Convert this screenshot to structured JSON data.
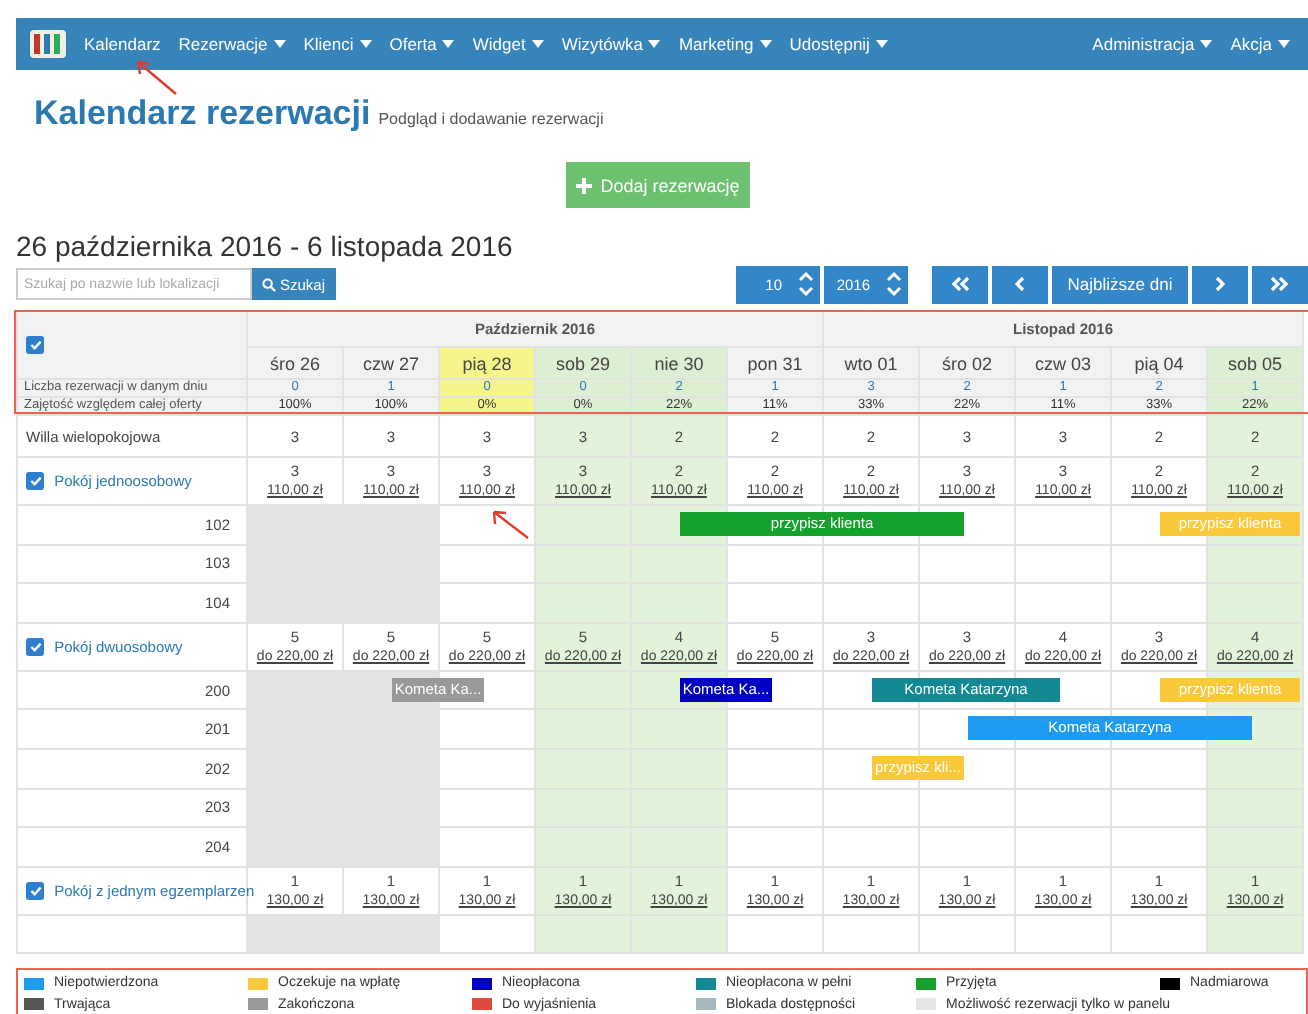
{
  "nav": {
    "items": [
      {
        "label": "Kalendarz",
        "dropdown": false
      },
      {
        "label": "Rezerwacje",
        "dropdown": true
      },
      {
        "label": "Klienci",
        "dropdown": true
      },
      {
        "label": "Oferta",
        "dropdown": true
      },
      {
        "label": "Widget",
        "dropdown": true
      },
      {
        "label": "Wizytówka",
        "dropdown": true
      },
      {
        "label": "Marketing",
        "dropdown": true
      },
      {
        "label": "Udostępnij",
        "dropdown": true
      }
    ],
    "right_items": [
      {
        "label": "Administracja",
        "dropdown": true
      },
      {
        "label": "Akcja",
        "dropdown": true
      }
    ]
  },
  "page": {
    "title": "Kalendarz rezerwacji",
    "subtitle": "Podgląd i dodawanie rezerwacji"
  },
  "add_button": "Dodaj rezerwację",
  "range_title": "26 października 2016 - 6 listopada 2016",
  "search": {
    "placeholder": "Szukaj po nazwie lub lokalizacji",
    "button": "Szukaj"
  },
  "pager": {
    "month": "10",
    "year": "2016",
    "nearest": "Najbliższe dni"
  },
  "calendar": {
    "select_all_checked": true,
    "stat_labels": [
      "Liczba rezerwacji w danym dniu",
      "Zajętość względem całej oferty"
    ],
    "months": [
      {
        "label": "Październik 2016",
        "days": [
          {
            "label": "śro 26",
            "kind": "past",
            "count": "0",
            "occupancy": "100%"
          },
          {
            "label": "czw 27",
            "kind": "past",
            "count": "1",
            "occupancy": "100%"
          },
          {
            "label": "pią 28",
            "kind": "today",
            "count": "0",
            "occupancy": "0%"
          },
          {
            "label": "sob 29",
            "kind": "weekend",
            "count": "0",
            "occupancy": "0%"
          },
          {
            "label": "nie 30",
            "kind": "weekend",
            "count": "2",
            "occupancy": "22%"
          },
          {
            "label": "pon 31",
            "kind": "normal",
            "count": "1",
            "occupancy": "11%"
          }
        ]
      },
      {
        "label": "Listopad 2016",
        "days": [
          {
            "label": "wto 01",
            "kind": "normal",
            "count": "3",
            "occupancy": "33%"
          },
          {
            "label": "śro 02",
            "kind": "normal",
            "count": "2",
            "occupancy": "22%"
          },
          {
            "label": "czw 03",
            "kind": "normal",
            "count": "1",
            "occupancy": "11%"
          },
          {
            "label": "pią 04",
            "kind": "normal",
            "count": "2",
            "occupancy": "33%"
          },
          {
            "label": "sob 05",
            "kind": "weekend",
            "count": "1",
            "occupancy": "22%"
          }
        ]
      }
    ],
    "rows": [
      {
        "kind": "property",
        "name": "Willa wielopokojowa",
        "cells": [
          "3",
          "3",
          "3",
          "3",
          "2",
          "2",
          "2",
          "3",
          "3",
          "2",
          "2"
        ]
      },
      {
        "kind": "room_type",
        "name": "Pokój jednoosobowy",
        "checked": true,
        "cells": [
          {
            "count": "3",
            "price": "110,00 zł"
          },
          {
            "count": "3",
            "price": "110,00 zł"
          },
          {
            "count": "3",
            "price": "110,00 zł"
          },
          {
            "count": "3",
            "price": "110,00 zł"
          },
          {
            "count": "2",
            "price": "110,00 zł"
          },
          {
            "count": "2",
            "price": "110,00 zł"
          },
          {
            "count": "2",
            "price": "110,00 zł"
          },
          {
            "count": "3",
            "price": "110,00 zł"
          },
          {
            "count": "3",
            "price": "110,00 zł"
          },
          {
            "count": "2",
            "price": "110,00 zł"
          },
          {
            "count": "2",
            "price": "110,00 zł"
          }
        ]
      },
      {
        "kind": "room",
        "name": "102",
        "slots": [
          {
            "kind": "free"
          },
          {
            "kind": "free"
          },
          {
            "kind": "free"
          },
          {
            "kind": "free"
          },
          {
            "kind": "booking",
            "label": "przypisz klienta",
            "color": "#16a02e"
          },
          {
            "kind": "stay"
          },
          {
            "kind": "stay"
          },
          {
            "kind": "free"
          },
          {
            "kind": "free"
          },
          {
            "kind": "booking",
            "label": "przypisz klienta",
            "color": "#f9c93b"
          },
          {
            "kind": "stay"
          }
        ]
      },
      {
        "kind": "room",
        "name": "103",
        "slots": [
          {
            "kind": "free"
          },
          {
            "kind": "free"
          },
          {
            "kind": "free"
          },
          {
            "kind": "free"
          },
          {
            "kind": "free"
          },
          {
            "kind": "free"
          },
          {
            "kind": "free"
          },
          {
            "kind": "free"
          },
          {
            "kind": "free"
          },
          {
            "kind": "free"
          },
          {
            "kind": "free"
          }
        ]
      },
      {
        "kind": "room",
        "name": "104",
        "slots": [
          {
            "kind": "free"
          },
          {
            "kind": "free"
          },
          {
            "kind": "free"
          },
          {
            "kind": "free"
          },
          {
            "kind": "free"
          },
          {
            "kind": "free"
          },
          {
            "kind": "free"
          },
          {
            "kind": "free"
          },
          {
            "kind": "free"
          },
          {
            "kind": "free"
          },
          {
            "kind": "free"
          }
        ]
      },
      {
        "kind": "room_type",
        "name": "Pokój dwuosobowy",
        "checked": true,
        "cells": [
          {
            "count": "5",
            "price": "do 220,00 zł"
          },
          {
            "count": "5",
            "price": "do 220,00 zł"
          },
          {
            "count": "5",
            "price": "do 220,00 zł"
          },
          {
            "count": "5",
            "price": "do 220,00 zł"
          },
          {
            "count": "4",
            "price": "do 220,00 zł"
          },
          {
            "count": "5",
            "price": "do 220,00 zł"
          },
          {
            "count": "3",
            "price": "do 220,00 zł"
          },
          {
            "count": "3",
            "price": "do 220,00 zł"
          },
          {
            "count": "4",
            "price": "do 220,00 zł"
          },
          {
            "count": "3",
            "price": "do 220,00 zł"
          },
          {
            "count": "4",
            "price": "do 220,00 zł"
          }
        ]
      },
      {
        "kind": "room",
        "name": "200",
        "slots": [
          {
            "kind": "free"
          },
          {
            "kind": "booking",
            "label": "Kometa Ka...",
            "color": "#999999"
          },
          {
            "kind": "free"
          },
          {
            "kind": "free"
          },
          {
            "kind": "booking",
            "label": "Kometa Ka...",
            "color": "#0000c0"
          },
          {
            "kind": "free"
          },
          {
            "kind": "booking",
            "label": "Kometa Katarzyna",
            "color": "#138a93"
          },
          {
            "kind": "stay"
          },
          {
            "kind": "free"
          },
          {
            "kind": "booking",
            "label": "przypisz klienta",
            "color": "#f9c93b"
          },
          {
            "kind": "stay"
          }
        ]
      },
      {
        "kind": "room",
        "name": "201",
        "slots": [
          {
            "kind": "free"
          },
          {
            "kind": "free"
          },
          {
            "kind": "free"
          },
          {
            "kind": "free"
          },
          {
            "kind": "free"
          },
          {
            "kind": "free"
          },
          {
            "kind": "free"
          },
          {
            "kind": "booking",
            "label": "Kometa Katarzyna",
            "color": "#1e9bf0"
          },
          {
            "kind": "stay"
          },
          {
            "kind": "stay"
          },
          {
            "kind": "free"
          }
        ]
      },
      {
        "kind": "room",
        "name": "202",
        "slots": [
          {
            "kind": "free"
          },
          {
            "kind": "free"
          },
          {
            "kind": "free"
          },
          {
            "kind": "free"
          },
          {
            "kind": "free"
          },
          {
            "kind": "free"
          },
          {
            "kind": "booking",
            "label": "przypisz kli...",
            "color": "#f9c93b"
          },
          {
            "kind": "free"
          },
          {
            "kind": "free"
          },
          {
            "kind": "free"
          },
          {
            "kind": "free"
          }
        ]
      },
      {
        "kind": "room",
        "name": "203",
        "slots": [
          {
            "kind": "free"
          },
          {
            "kind": "free"
          },
          {
            "kind": "free"
          },
          {
            "kind": "free"
          },
          {
            "kind": "free"
          },
          {
            "kind": "free"
          },
          {
            "kind": "free"
          },
          {
            "kind": "free"
          },
          {
            "kind": "free"
          },
          {
            "kind": "free"
          },
          {
            "kind": "free"
          }
        ]
      },
      {
        "kind": "room",
        "name": "204",
        "slots": [
          {
            "kind": "free"
          },
          {
            "kind": "free"
          },
          {
            "kind": "free"
          },
          {
            "kind": "free"
          },
          {
            "kind": "free"
          },
          {
            "kind": "free"
          },
          {
            "kind": "free"
          },
          {
            "kind": "free"
          },
          {
            "kind": "free"
          },
          {
            "kind": "free"
          },
          {
            "kind": "free"
          }
        ]
      },
      {
        "kind": "room_type",
        "name": "Pokój z jednym egzemplarzen",
        "checked": true,
        "cells": [
          {
            "count": "1",
            "price": "130,00 zł"
          },
          {
            "count": "1",
            "price": "130,00 zł"
          },
          {
            "count": "1",
            "price": "130,00 zł"
          },
          {
            "count": "1",
            "price": "130,00 zł"
          },
          {
            "count": "1",
            "price": "130,00 zł"
          },
          {
            "count": "1",
            "price": "130,00 zł"
          },
          {
            "count": "1",
            "price": "130,00 zł"
          },
          {
            "count": "1",
            "price": "130,00 zł"
          },
          {
            "count": "1",
            "price": "130,00 zł"
          },
          {
            "count": "1",
            "price": "130,00 zł"
          },
          {
            "count": "1",
            "price": "130,00 zł"
          }
        ]
      },
      {
        "kind": "room",
        "slots": [
          {
            "kind": "free"
          },
          {
            "kind": "free"
          },
          {
            "kind": "free"
          },
          {
            "kind": "free"
          },
          {
            "kind": "free"
          },
          {
            "kind": "free"
          },
          {
            "kind": "free"
          },
          {
            "kind": "free"
          },
          {
            "kind": "free"
          },
          {
            "kind": "free"
          },
          {
            "kind": "free"
          }
        ]
      }
    ]
  },
  "legend": [
    {
      "label": "Niepotwierdzona",
      "color": "#1e9bf0"
    },
    {
      "label": "Oczekuje na wpłatę",
      "color": "#f9c93b"
    },
    {
      "label": "Nieopłacona",
      "color": "#0000c0"
    },
    {
      "label": "Nieopłacona w pełni",
      "color": "#138a93"
    },
    {
      "label": "Przyjęta",
      "color": "#16a02e"
    },
    {
      "label": "Nadmiarowa",
      "color": "#000000"
    },
    {
      "label": "Trwająca",
      "color": "#555555"
    },
    {
      "label": "Zakończona",
      "color": "#999999"
    },
    {
      "label": "Do wyjaśnienia",
      "color": "#e04a3a"
    },
    {
      "label": "Blokada dostępności",
      "color": "#a8b8c0"
    },
    {
      "label": "Możliwość rezerwacji tylko w panelu",
      "color": "#e6e6e6"
    }
  ]
}
